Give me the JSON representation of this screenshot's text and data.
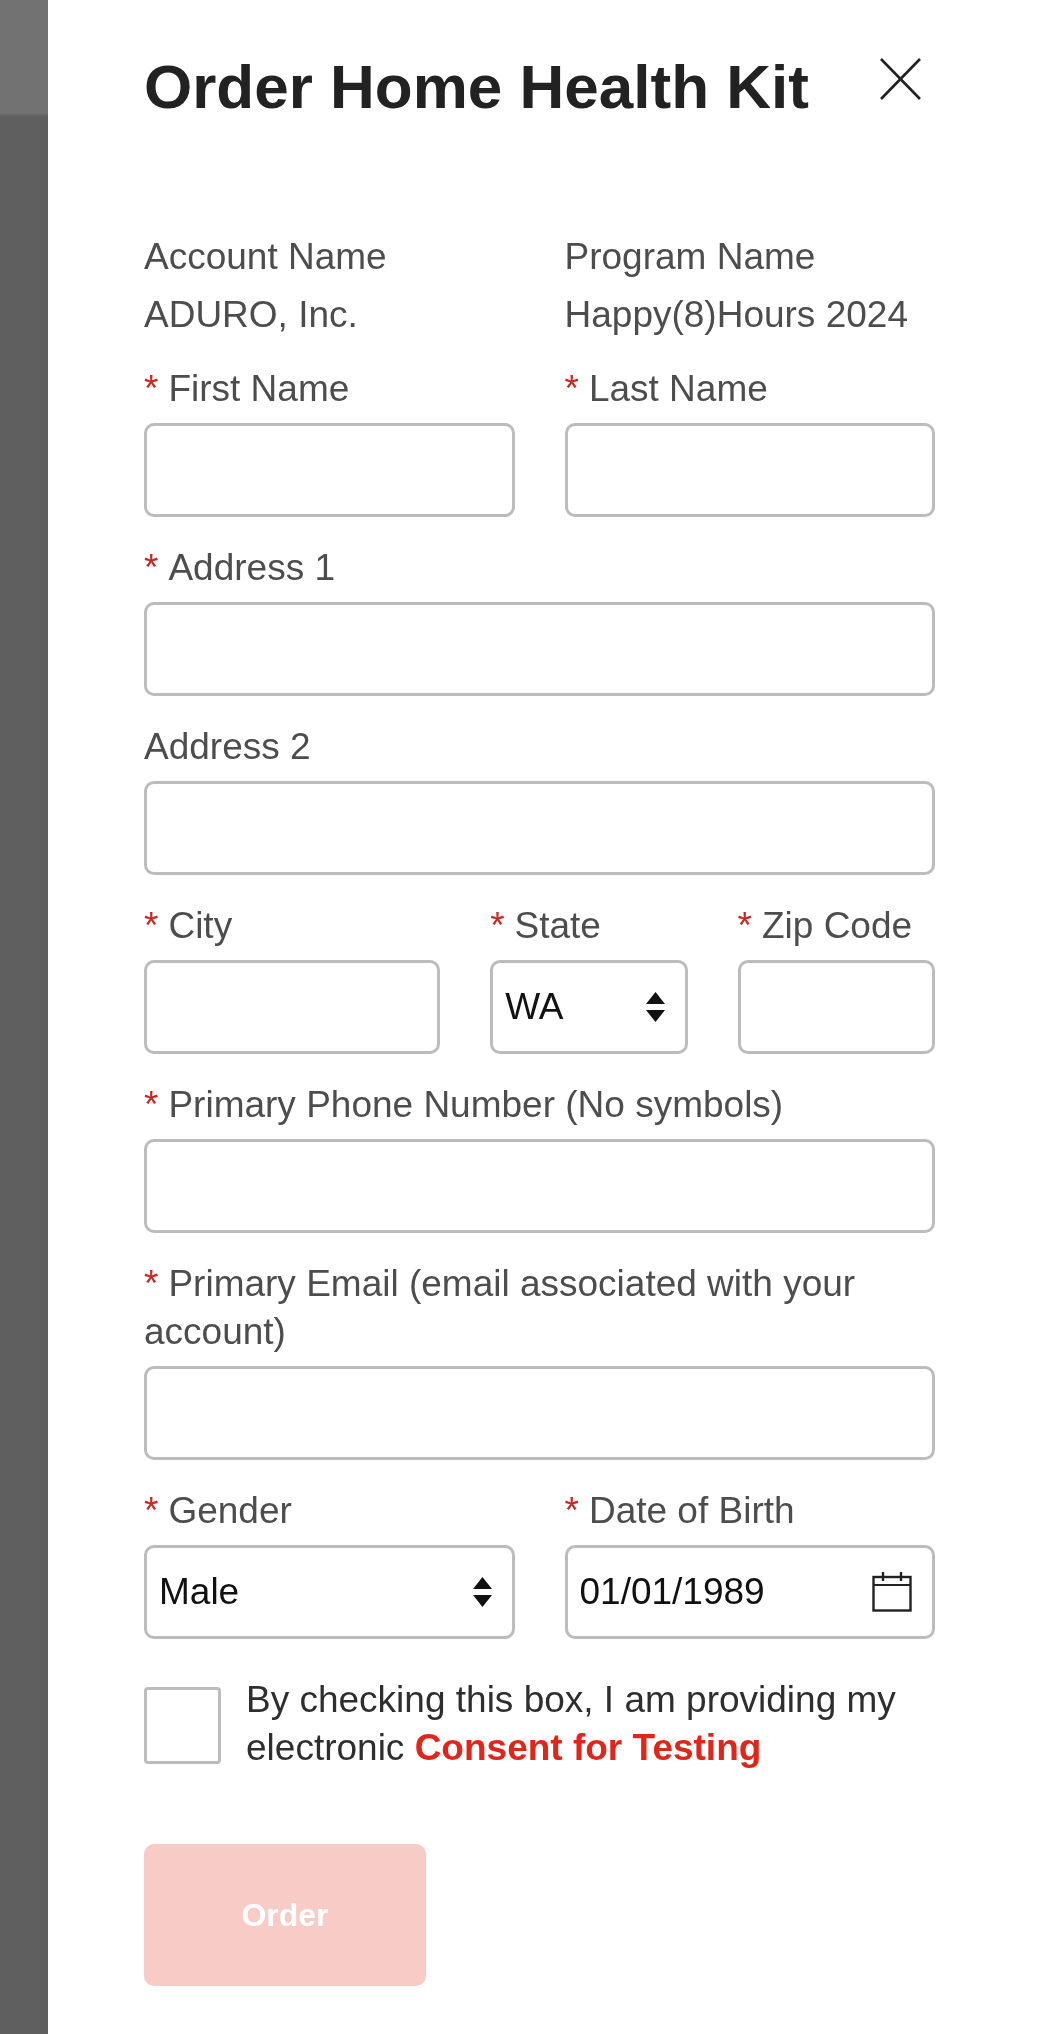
{
  "dialog": {
    "title": "Order Home Health Kit"
  },
  "info": [
    {
      "label": "Account Name",
      "value": "ADURO, Inc."
    },
    {
      "label": "Program Name",
      "value": "Happy(8)Hours 2024"
    }
  ],
  "form": {
    "rows": [
      {
        "fields": [
          {
            "kind": "text",
            "marker": "*",
            "label": "First Name"
          },
          {
            "kind": "text",
            "marker": "*",
            "label": "Last Name"
          }
        ]
      },
      {
        "fields": [
          {
            "kind": "text",
            "marker": "*",
            "label": "Address 1"
          }
        ]
      },
      {
        "fields": [
          {
            "kind": "text",
            "label": "Address 2"
          }
        ]
      },
      {
        "fields": [
          {
            "kind": "text",
            "marker": "*",
            "label": "City"
          },
          {
            "kind": "select",
            "marker": "*",
            "label": "State",
            "value": "WA"
          },
          {
            "kind": "text",
            "marker": "*",
            "label": "Zip Code"
          }
        ]
      },
      {
        "fields": [
          {
            "kind": "text",
            "marker": "*",
            "label": "Primary Phone Number (No symbols)"
          }
        ]
      },
      {
        "fields": [
          {
            "kind": "text",
            "marker": "*",
            "label": "Primary Email (email associated with your account)"
          }
        ]
      },
      {
        "fields": [
          {
            "kind": "select",
            "marker": "*",
            "label": "Gender",
            "value": "Male"
          },
          {
            "kind": "date",
            "marker": "*",
            "label": "Date of Birth",
            "value": "01/01/1989"
          }
        ]
      }
    ]
  },
  "consent": {
    "checked": false,
    "text": "By checking this box, I am providing my electronic",
    "link": "Consent for Testing"
  },
  "order_button": {
    "label": "Order",
    "disabled": true
  }
}
